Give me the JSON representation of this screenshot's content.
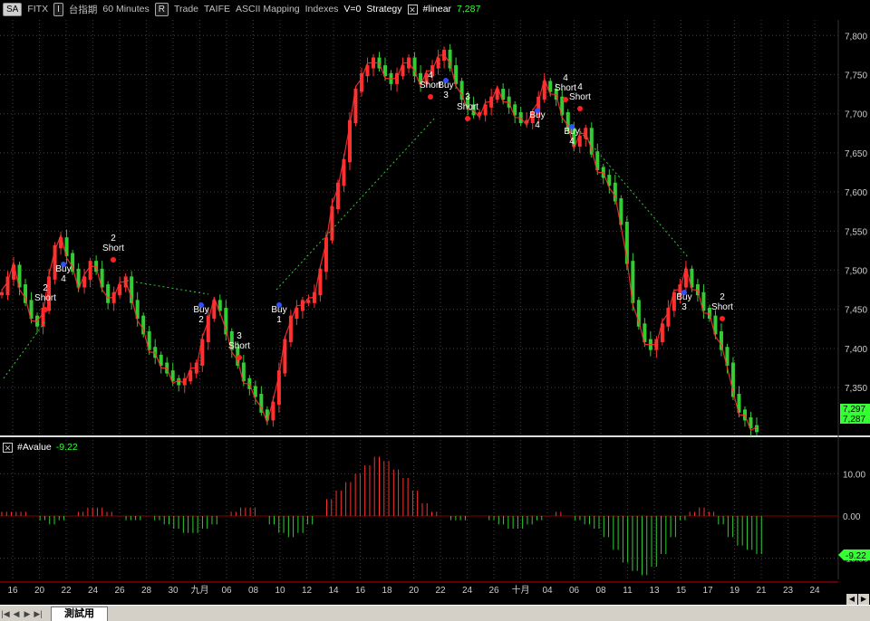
{
  "toolbar": {
    "symbol_btn": "SA",
    "symbol": "FITX",
    "interval_btn": "I",
    "name": "台指期",
    "interval": "60 Minutes",
    "replay_btn": "R",
    "mode": "Trade",
    "exchange": "TAIFE",
    "mapping": "ASCII Mapping",
    "category": "Indexes",
    "volume": "V=0",
    "strategy": "Strategy",
    "indicator": "#linear",
    "indicator_value": "7,287"
  },
  "subpanel": {
    "indicator": "#Avalue",
    "value": "-9.22"
  },
  "price_axis": {
    "ticks": [
      "7,800",
      "7,750",
      "7,700",
      "7,650",
      "7,600",
      "7,550",
      "7,500",
      "7,450",
      "7,400",
      "7,350"
    ],
    "last_labels": [
      "7,297",
      "7,287"
    ]
  },
  "osc_axis": {
    "ticks": [
      "10.00",
      "0.00",
      "-10.00"
    ],
    "last_label": "-9.22"
  },
  "date_axis": [
    "16",
    "20",
    "22",
    "24",
    "26",
    "28",
    "30",
    "九月",
    "06",
    "08",
    "10",
    "12",
    "14",
    "16",
    "18",
    "20",
    "22",
    "24",
    "26",
    "十月",
    "04",
    "06",
    "08",
    "11",
    "13",
    "15",
    "17",
    "19",
    "21",
    "23",
    "24"
  ],
  "signals": [
    {
      "label": "Short",
      "num": "2"
    },
    {
      "label": "Buy",
      "num": "4"
    },
    {
      "label": "Short",
      "num": "2"
    },
    {
      "label": "Buy",
      "num": "2"
    },
    {
      "label": "Short",
      "num": "3"
    },
    {
      "label": "Buy",
      "num": "1"
    },
    {
      "label": "Short",
      "num": "4"
    },
    {
      "label": "Buy",
      "num": "3"
    },
    {
      "label": "Short",
      "num": "3"
    },
    {
      "label": "Buy",
      "num": "4"
    },
    {
      "label": "Short",
      "num": "4"
    },
    {
      "label": "Short",
      "num": "4"
    },
    {
      "label": "Buy",
      "num": "4"
    },
    {
      "label": "Buy",
      "num": "3"
    },
    {
      "label": "Short",
      "num": "2"
    }
  ],
  "bottom": {
    "sheet_tab": "測試用"
  },
  "colors": {
    "up": "#ff3030",
    "down": "#33cc33",
    "grid": "#404040",
    "separator": "#c00000",
    "accent_green": "#33ff33"
  },
  "chart_data": {
    "type": "candlestick",
    "ylim": [
      7290,
      7820
    ],
    "osc_ylim": [
      -15,
      15
    ],
    "close_path": [
      7470,
      7490,
      7505,
      7480,
      7460,
      7440,
      7430,
      7450,
      7490,
      7530,
      7540,
      7520,
      7500,
      7480,
      7490,
      7510,
      7500,
      7480,
      7460,
      7470,
      7480,
      7490,
      7460,
      7440,
      7420,
      7400,
      7390,
      7380,
      7370,
      7360,
      7355,
      7360,
      7370,
      7380,
      7410,
      7440,
      7460,
      7450,
      7420,
      7400,
      7380,
      7360,
      7350,
      7340,
      7320,
      7310,
      7330,
      7370,
      7410,
      7440,
      7450,
      7460,
      7460,
      7470,
      7500,
      7540,
      7580,
      7610,
      7640,
      7690,
      7730,
      7750,
      7760,
      7770,
      7760,
      7750,
      7740,
      7750,
      7760,
      7770,
      7750,
      7740,
      7750,
      7760,
      7770,
      7780,
      7760,
      7740,
      7720,
      7710,
      7700,
      7700,
      7710,
      7720,
      7730,
      7720,
      7710,
      7700,
      7690,
      7690,
      7700,
      7720,
      7740,
      7730,
      7720,
      7700,
      7680,
      7660,
      7670,
      7680,
      7650,
      7630,
      7620,
      7610,
      7590,
      7560,
      7510,
      7460,
      7430,
      7410,
      7400,
      7410,
      7430,
      7450,
      7470,
      7480,
      7500,
      7480,
      7470,
      7450,
      7440,
      7420,
      7400,
      7380,
      7340,
      7320,
      7310,
      7300,
      7295
    ],
    "oscillator": [
      1,
      1,
      1,
      0,
      -1,
      -2,
      -1,
      0,
      1,
      2,
      2,
      1,
      0,
      -1,
      -1,
      0,
      -1,
      -2,
      -3,
      -4,
      -4,
      -3,
      -2,
      0,
      1,
      2,
      2,
      0,
      -2,
      -4,
      -5,
      -4,
      -2,
      0,
      4,
      6,
      8,
      10,
      12,
      14,
      13,
      11,
      9,
      6,
      3,
      1,
      0,
      -1,
      -1,
      0,
      0,
      -1,
      -2,
      -3,
      -3,
      -2,
      -1,
      0,
      1,
      0,
      -1,
      -2,
      -3,
      -5,
      -8,
      -11,
      -13,
      -14,
      -12,
      -9,
      -5,
      -1,
      1,
      2,
      1,
      -2,
      -5,
      -7,
      -8,
      -9
    ]
  }
}
